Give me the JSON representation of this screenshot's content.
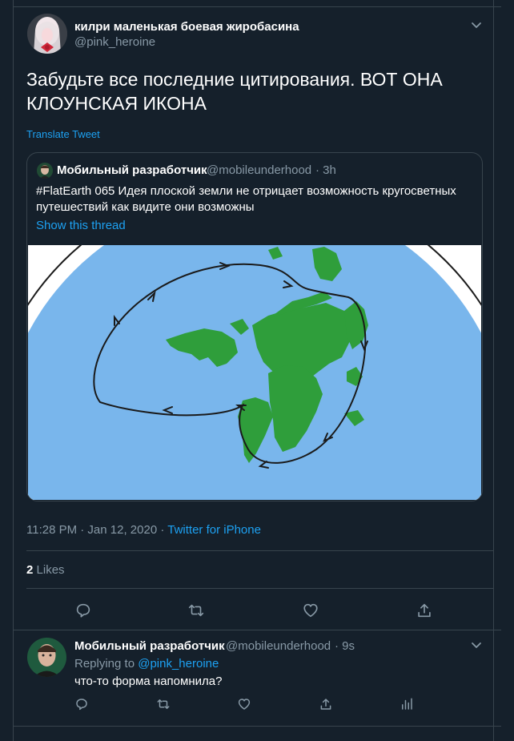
{
  "tweet": {
    "display_name": "килри маленькая боевая жиробасина",
    "handle": "@pink_heroine",
    "text_line1": "Забудьте все последние цитирования. ВОТ ОНА",
    "text_line2": "КЛОУНСКАЯ ИКОНА",
    "translate_label": "Translate Tweet",
    "time": "11:28 PM · Jan 12, 2020",
    "separator": " · ",
    "client": "Twitter for iPhone",
    "likes_count": "2",
    "likes_label": "Likes"
  },
  "quoted": {
    "display_name": "Мобильный разработчик",
    "handle": "@mobileunderhood",
    "time": "· 3h",
    "text_line1": "#FlatEarth 065 Идея плоской земли не отрицает возможность кругосветных",
    "text_line2": "путешествий как видите они возможны",
    "show_thread": "Show this thread"
  },
  "reply": {
    "display_name": "Мобильный разработчик",
    "handle": "@mobileunderhood",
    "time": "· 9s",
    "replying_prefix": "Replying to",
    "replying_handle": "@pink_heroine",
    "text": "что-то форма напомнила?"
  },
  "colors": {
    "background": "#15202b",
    "border": "#38444d",
    "muted": "#8899a6",
    "link": "#1da1f2",
    "ocean": "#79b6ec",
    "land": "#2f9e3b"
  },
  "icons": [
    "chevron-down-icon",
    "reply-icon",
    "retweet-icon",
    "like-icon",
    "share-icon",
    "analytics-icon"
  ]
}
